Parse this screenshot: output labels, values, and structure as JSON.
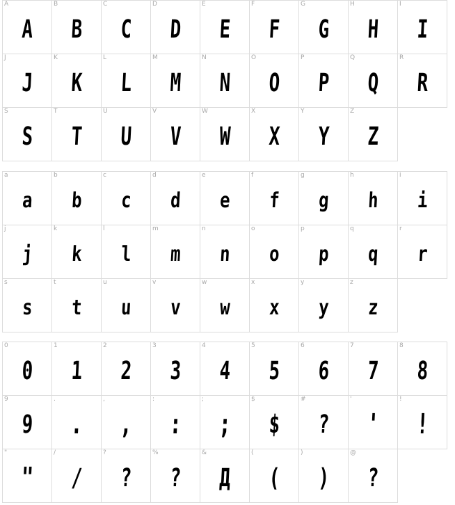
{
  "blocks": [
    {
      "cells": [
        {
          "label": "A",
          "glyph": "A"
        },
        {
          "label": "B",
          "glyph": "B"
        },
        {
          "label": "C",
          "glyph": "C"
        },
        {
          "label": "D",
          "glyph": "D"
        },
        {
          "label": "E",
          "glyph": "E"
        },
        {
          "label": "F",
          "glyph": "F"
        },
        {
          "label": "G",
          "glyph": "G"
        },
        {
          "label": "H",
          "glyph": "H"
        },
        {
          "label": "I",
          "glyph": "I"
        },
        {
          "label": "J",
          "glyph": "J"
        },
        {
          "label": "K",
          "glyph": "K"
        },
        {
          "label": "L",
          "glyph": "L"
        },
        {
          "label": "M",
          "glyph": "M"
        },
        {
          "label": "N",
          "glyph": "N"
        },
        {
          "label": "O",
          "glyph": "O"
        },
        {
          "label": "P",
          "glyph": "P"
        },
        {
          "label": "Q",
          "glyph": "Q"
        },
        {
          "label": "R",
          "glyph": "R"
        },
        {
          "label": "S",
          "glyph": "S"
        },
        {
          "label": "T",
          "glyph": "T"
        },
        {
          "label": "U",
          "glyph": "U"
        },
        {
          "label": "V",
          "glyph": "V"
        },
        {
          "label": "W",
          "glyph": "W"
        },
        {
          "label": "X",
          "glyph": "X"
        },
        {
          "label": "Y",
          "glyph": "Y"
        },
        {
          "label": "Z",
          "glyph": "Z"
        }
      ]
    },
    {
      "cells": [
        {
          "label": "a",
          "glyph": "a"
        },
        {
          "label": "b",
          "glyph": "b"
        },
        {
          "label": "c",
          "glyph": "c"
        },
        {
          "label": "d",
          "glyph": "d"
        },
        {
          "label": "e",
          "glyph": "e"
        },
        {
          "label": "f",
          "glyph": "f"
        },
        {
          "label": "g",
          "glyph": "g"
        },
        {
          "label": "h",
          "glyph": "h"
        },
        {
          "label": "i",
          "glyph": "i"
        },
        {
          "label": "j",
          "glyph": "j"
        },
        {
          "label": "k",
          "glyph": "k"
        },
        {
          "label": "l",
          "glyph": "l"
        },
        {
          "label": "m",
          "glyph": "m"
        },
        {
          "label": "n",
          "glyph": "n"
        },
        {
          "label": "o",
          "glyph": "o"
        },
        {
          "label": "p",
          "glyph": "p"
        },
        {
          "label": "q",
          "glyph": "q"
        },
        {
          "label": "r",
          "glyph": "r"
        },
        {
          "label": "s",
          "glyph": "s"
        },
        {
          "label": "t",
          "glyph": "t"
        },
        {
          "label": "u",
          "glyph": "u"
        },
        {
          "label": "v",
          "glyph": "v"
        },
        {
          "label": "w",
          "glyph": "w"
        },
        {
          "label": "x",
          "glyph": "x"
        },
        {
          "label": "y",
          "glyph": "y"
        },
        {
          "label": "z",
          "glyph": "z"
        }
      ]
    },
    {
      "cells": [
        {
          "label": "0",
          "glyph": "0"
        },
        {
          "label": "1",
          "glyph": "1"
        },
        {
          "label": "2",
          "glyph": "2"
        },
        {
          "label": "3",
          "glyph": "3"
        },
        {
          "label": "4",
          "glyph": "4"
        },
        {
          "label": "5",
          "glyph": "5"
        },
        {
          "label": "6",
          "glyph": "6"
        },
        {
          "label": "7",
          "glyph": "7"
        },
        {
          "label": "8",
          "glyph": "8"
        },
        {
          "label": "9",
          "glyph": "9"
        },
        {
          "label": ".",
          "glyph": "."
        },
        {
          "label": ",",
          "glyph": ","
        },
        {
          "label": ":",
          "glyph": ":"
        },
        {
          "label": ";",
          "glyph": ";"
        },
        {
          "label": "$",
          "glyph": "$"
        },
        {
          "label": "#",
          "glyph": "?"
        },
        {
          "label": "'",
          "glyph": "'"
        },
        {
          "label": "!",
          "glyph": "!"
        },
        {
          "label": "\"",
          "glyph": "\""
        },
        {
          "label": "/",
          "glyph": "/"
        },
        {
          "label": "?",
          "glyph": "?"
        },
        {
          "label": "%",
          "glyph": "?"
        },
        {
          "label": "&",
          "glyph": "Д"
        },
        {
          "label": "(",
          "glyph": "("
        },
        {
          "label": ")",
          "glyph": ")"
        },
        {
          "label": "@",
          "glyph": "?"
        }
      ]
    }
  ]
}
